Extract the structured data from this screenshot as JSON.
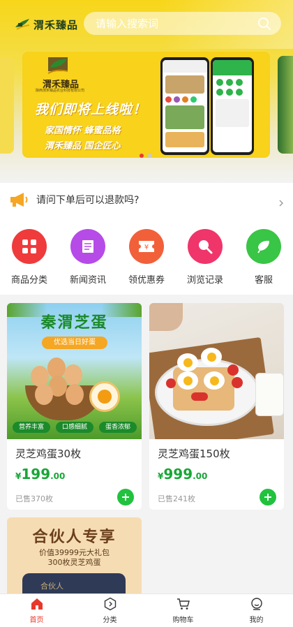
{
  "header": {
    "brand_name": "渭禾臻品",
    "search_placeholder": "请输入搜索词"
  },
  "banner": {
    "brand_name": "渭禾臻品",
    "company": "陕西渭禾臻品农业科技有限公司",
    "headline": "我们即将上线啦！",
    "line1": "家国情怀  蜂蜜品格",
    "line2": "渭禾臻品  国企匠心",
    "pages": 2,
    "active_page": 1
  },
  "notice": {
    "text": "请问下单后可以退款吗?"
  },
  "quick_nav": [
    {
      "label": "商品分类",
      "icon": "grid-icon",
      "color": "#ef3b3b"
    },
    {
      "label": "新闻资讯",
      "icon": "news-icon",
      "color": "#b64be8"
    },
    {
      "label": "领优惠券",
      "icon": "coupon-icon",
      "color": "#f2603a"
    },
    {
      "label": "浏览记录",
      "icon": "history-icon",
      "color": "#f0356a"
    },
    {
      "label": "客服",
      "icon": "service-icon",
      "color": "#39c545"
    }
  ],
  "products": [
    {
      "name": "灵芝鸡蛋30枚",
      "currency": "¥",
      "price_int": "199",
      "price_dec": ".00",
      "sold": "已售370枚",
      "img_title": "秦渭芝蛋",
      "img_tag": "优选当日好蛋",
      "img_badges": [
        "营养丰富",
        "口感细腻",
        "蛋香浓郁"
      ]
    },
    {
      "name": "灵芝鸡蛋150枚",
      "currency": "¥",
      "price_int": "999",
      "price_dec": ".00",
      "sold": "已售241枚"
    },
    {
      "img_title": "合伙人专享",
      "img_line1": "价值39999元大礼包",
      "img_line2": "300枚灵芝鸡蛋",
      "img_card": "合伙人"
    }
  ],
  "tabbar": [
    {
      "label": "首页",
      "icon": "home-icon",
      "active": true
    },
    {
      "label": "分类",
      "icon": "category-icon",
      "active": false
    },
    {
      "label": "购物车",
      "icon": "cart-icon",
      "active": false
    },
    {
      "label": "我的",
      "icon": "profile-icon",
      "active": false
    }
  ],
  "colors": {
    "accent_green": "#1aa637",
    "active_red": "#e8382b",
    "header_yellow": "#f7d61a"
  }
}
